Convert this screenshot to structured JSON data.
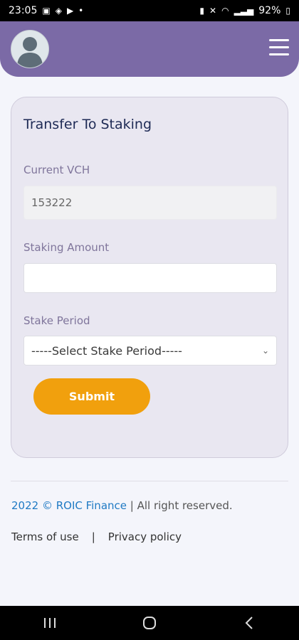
{
  "status_bar": {
    "time": "23:05",
    "battery": "92%"
  },
  "header": {
    "avatar_icon": "user-avatar-icon",
    "menu_icon": "hamburger-menu-icon"
  },
  "form": {
    "title": "Transfer To Staking",
    "current_vch_label": "Current VCH",
    "current_vch_value": "153222",
    "staking_amount_label": "Staking Amount",
    "staking_amount_value": "",
    "stake_period_label": "Stake Period",
    "stake_period_selected": "-----Select Stake Period-----",
    "submit_label": "Submit"
  },
  "footer": {
    "copyright_brand": "2022 © ROIC Finance",
    "copyright_rest": " | All right reserved.",
    "terms_label": "Terms of use",
    "separator": "|",
    "privacy_label": "Privacy policy"
  },
  "colors": {
    "header": "#7b6aa6",
    "accent": "#f1a00d",
    "link": "#1f7ac4",
    "title": "#1e2a55"
  }
}
